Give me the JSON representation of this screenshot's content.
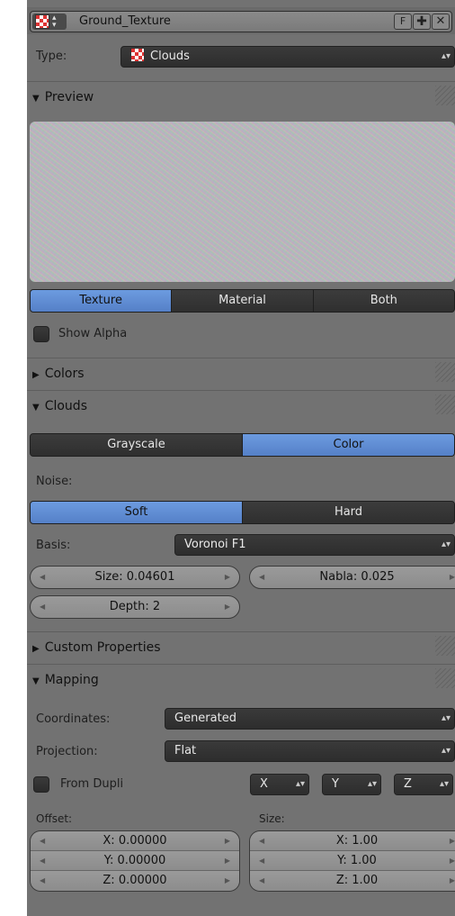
{
  "header": {
    "texture_name": "Ground_Texture",
    "fake_user_label": "F",
    "new_icon": "plus-icon",
    "unlink_icon": "close-icon"
  },
  "type": {
    "label": "Type:",
    "value": "Clouds"
  },
  "preview": {
    "title": "Preview",
    "tabs": [
      "Texture",
      "Material",
      "Both"
    ],
    "active_tab": "Texture",
    "show_alpha_label": "Show Alpha"
  },
  "colors_section": {
    "title": "Colors"
  },
  "clouds": {
    "title": "Clouds",
    "color_modes": [
      "Grayscale",
      "Color"
    ],
    "active_color_mode": "Color",
    "noise_label": "Noise:",
    "noise_types": [
      "Soft",
      "Hard"
    ],
    "active_noise": "Soft",
    "basis_label": "Basis:",
    "basis_value": "Voronoi F1",
    "size": "Size: 0.04601",
    "nabla": "Nabla: 0.025",
    "depth": "Depth: 2"
  },
  "custom_properties": {
    "title": "Custom Properties"
  },
  "mapping": {
    "title": "Mapping",
    "coordinates_label": "Coordinates:",
    "coordinates_value": "Generated",
    "projection_label": "Projection:",
    "projection_value": "Flat",
    "from_dupli_label": "From Dupli",
    "axes": [
      "X",
      "Y",
      "Z"
    ],
    "offset_label": "Offset:",
    "offset": [
      "X: 0.00000",
      "Y: 0.00000",
      "Z: 0.00000"
    ],
    "size_label": "Size:",
    "size": [
      "X: 1.00",
      "Y: 1.00",
      "Z: 1.00"
    ]
  },
  "colors": {
    "accent": "#5a8ad4",
    "panel": "#727272",
    "widget_dark": "#2d2d2d"
  }
}
